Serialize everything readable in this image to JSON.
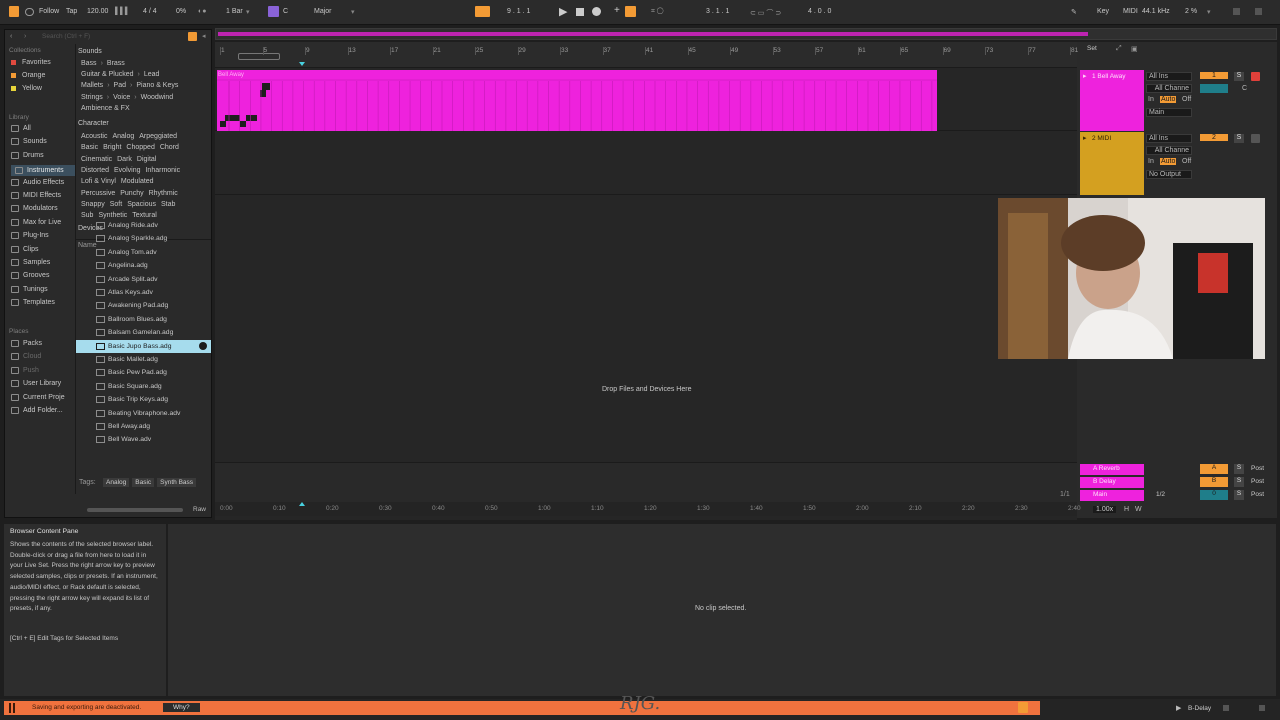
{
  "topbar": {
    "follow": "Follow",
    "tap": "Tap",
    "tempo": "120.00",
    "meter": "4 / 4",
    "cpu": "0%",
    "quantize": "1 Bar",
    "key_root": "C",
    "scale": "Major",
    "position": "9 . 1 . 1",
    "loop_start": "3 . 1 . 1",
    "loop_length": "4 . 0 . 0",
    "key_label": "Key",
    "midi_label": "MIDI",
    "sample_rate": "44.1 kHz",
    "cpu_meter": "2 %"
  },
  "browser": {
    "search_placeholder": "Search (Ctrl + F)",
    "collections_title": "Collections",
    "collections": [
      {
        "label": "Favorites",
        "color": "#e04a3f"
      },
      {
        "label": "Orange",
        "color": "#f39b35"
      },
      {
        "label": "Yellow",
        "color": "#e7d43a"
      }
    ],
    "library_title": "Library",
    "library": [
      "All",
      "Sounds",
      "Drums",
      "Instruments",
      "Audio Effects",
      "MIDI Effects",
      "Modulators",
      "Max for Live",
      "Plug-Ins",
      "Clips",
      "Samples",
      "Grooves",
      "Tunings",
      "Templates"
    ],
    "places_title": "Places",
    "places": [
      "Packs",
      "Cloud",
      "Push",
      "User Library",
      "Current Proje",
      "Add Folder..."
    ],
    "sounds_title": "Sounds",
    "sounds_rows": [
      [
        "Bass",
        "Brass"
      ],
      [
        "Guitar & Plucked",
        "Lead"
      ],
      [
        "Mallets",
        "Pad",
        "Piano & Keys"
      ],
      [
        "Strings",
        "Voice",
        "Woodwind"
      ],
      [
        "Ambience & FX"
      ]
    ],
    "character_title": "Character",
    "character_rows": [
      [
        "Acoustic",
        "Analog",
        "Arpeggiated"
      ],
      [
        "Basic",
        "Bright",
        "Chopped",
        "Chord"
      ],
      [
        "Cinematic",
        "Dark",
        "Digital"
      ],
      [
        "Distorted",
        "Evolving",
        "Inharmonic"
      ],
      [
        "Lofi & Vinyl",
        "Modulated"
      ],
      [
        "Percussive",
        "Punchy",
        "Rhythmic"
      ],
      [
        "Snappy",
        "Soft",
        "Spacious",
        "Stab"
      ],
      [
        "Sub",
        "Synthetic",
        "Textural"
      ]
    ],
    "devices_title": "Devices",
    "name_header": "Name",
    "files": [
      "Analog Ride.adv",
      "Analog Sparkle.adg",
      "Analog Tom.adv",
      "Angelina.adg",
      "Arcade Split.adv",
      "Atlas Keys.adv",
      "Awakening Pad.adg",
      "Ballroom Blues.adg",
      "Balsam Gamelan.adg",
      "Basic Jupo Bass.adg",
      "Basic Mallet.adg",
      "Basic Pew Pad.adg",
      "Basic Square.adg",
      "Basic Trip Keys.adg",
      "Beating Vibraphone.adv",
      "Bell Away.adg",
      "Bell Wave.adv"
    ],
    "selected_index": 9,
    "tags_label": "Tags:",
    "tags": [
      "Analog",
      "Basic",
      "Synth Bass"
    ],
    "raw_button": "Raw"
  },
  "arrangement": {
    "bar_numbers": [
      "1",
      "5",
      "9",
      "13",
      "17",
      "21",
      "25",
      "29",
      "33",
      "37",
      "41",
      "45",
      "49",
      "53",
      "57",
      "61",
      "65",
      "69",
      "73",
      "77",
      "81"
    ],
    "clip_name": "Bell Away",
    "clip_color": "#ee22dd",
    "drop_text": "Drop Files and Devices Here",
    "time_labels": [
      "0:00",
      "0:10",
      "0:20",
      "0:30",
      "0:40",
      "0:50",
      "1:00",
      "1:10",
      "1:20",
      "1:30",
      "1:40",
      "1:50",
      "2:00",
      "2:10",
      "2:20",
      "2:30",
      "2:40"
    ],
    "set_button": "Set",
    "page_indicator": "1/1"
  },
  "tracks": [
    {
      "name": "1 Bell Away",
      "color": "#ee22dd",
      "input": "All Ins",
      "channel": "All Channe",
      "monitor": [
        "In",
        "Auto",
        "Off"
      ],
      "output": "Main",
      "number": "1",
      "value": "C"
    },
    {
      "name": "2 MIDI",
      "color": "#d4a020",
      "input": "All Ins",
      "channel": "All Channe",
      "monitor": [
        "In",
        "Auto",
        "Off"
      ],
      "output": "No Output",
      "number": "2"
    }
  ],
  "returns": [
    {
      "name": "A Reverb",
      "letter": "A",
      "post": "Post",
      "color": "#ee22dd"
    },
    {
      "name": "B Delay",
      "letter": "B",
      "post": "Post",
      "color": "#ee22dd"
    },
    {
      "name": "Main",
      "letter": "0",
      "post": "Post",
      "color": "#ee22dd",
      "fraction": "1/2"
    }
  ],
  "main_zoom": "1.00x",
  "info": {
    "title": "Browser Content Pane",
    "body": "Shows the contents of the selected browser label. Double-click or drag a file from here to load it in your Live Set. Press the right arrow key to preview selected samples, clips or presets. If an instrument, audio/MIDI effect, or Rack default is selected, pressing the right arrow key will expand its list of presets, if any.",
    "shortcut": "[Ctrl + E] Edit Tags for Selected Items"
  },
  "detail": {
    "empty_text": "No clip selected."
  },
  "status": {
    "message": "Saving and exporting are deactivated.",
    "why_button": "Why?",
    "watermark": "RJG.",
    "right_label": "B-Delay"
  },
  "colors": {
    "accent": "#f39b35",
    "clip": "#ee22dd",
    "selection": "#a6dced"
  }
}
